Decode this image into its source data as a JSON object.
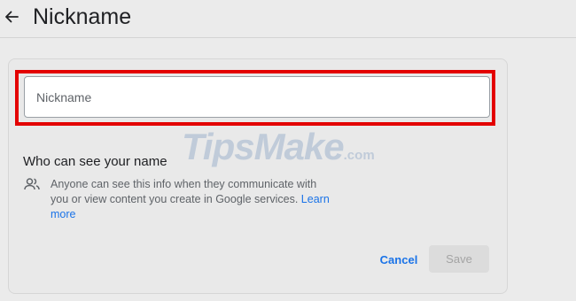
{
  "header": {
    "title": "Nickname"
  },
  "form": {
    "nickname_placeholder": "Nickname",
    "nickname_value": ""
  },
  "visibility": {
    "heading": "Who can see your name",
    "info_text": "Anyone can see this info when they communicate with you or view content you create in Google services.",
    "learn_more": "Learn more"
  },
  "actions": {
    "cancel_label": "Cancel",
    "save_label": "Save"
  },
  "watermark": {
    "text": "TipsMake",
    "suffix": ".com"
  },
  "icons": {
    "back": "arrow-back-icon",
    "people": "people-icon"
  },
  "colors": {
    "highlight": "#e30000",
    "link": "#1a73e8",
    "save_disabled": "#dcdcdc"
  }
}
